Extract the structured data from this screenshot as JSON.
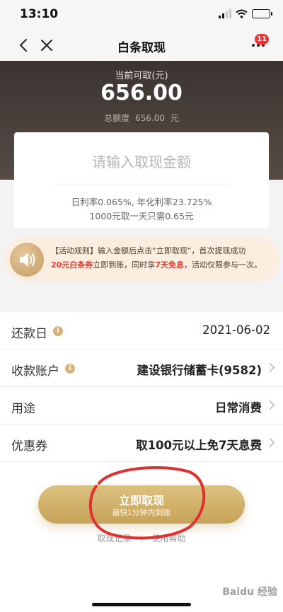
{
  "status": {
    "time": "13:10"
  },
  "nav": {
    "title": "白条取现",
    "badge": "11"
  },
  "header": {
    "available_label": "当前可取(元)",
    "available_amount": "656.00",
    "total_label": "总额度",
    "total_amount": "656.00",
    "total_unit": "元"
  },
  "card": {
    "placeholder": "请输入取现金额",
    "rate_line_1": "日利率0.065%, 年化利率23.725%",
    "rate_line_2": "1000元取一天只需0.65元"
  },
  "promo": {
    "line_1": "【活动规则】输入金额后点击“立即取现”，首次提现成功",
    "line_2_red_1": "20元白条券",
    "line_2_mid": "立即到账，同时享",
    "line_2_red_2": "7天免息",
    "line_2_end": "，活动仅限参与一次。"
  },
  "form": {
    "rows": [
      {
        "label": "还款日",
        "value": "2021-06-02"
      },
      {
        "label": "收款账户",
        "value": "建设银行储蓄卡(9582)"
      },
      {
        "label": "用途",
        "value": "日常消费"
      },
      {
        "label": "优惠券",
        "value": "取100元以上免7天息费"
      }
    ]
  },
  "submit": {
    "title": "立即取现",
    "subtitle": "最快1分钟内到账"
  },
  "links": {
    "history": "取现记录",
    "help": "使用帮助"
  },
  "watermark": "Baidu 经验",
  "colors": {
    "gold": "#c6a259",
    "header_dark": "#3a3330",
    "red": "#e23b2e",
    "annotation": "#e03030"
  }
}
